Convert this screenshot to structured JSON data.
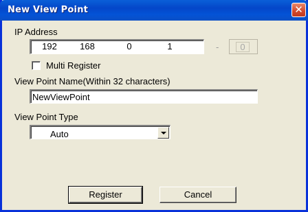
{
  "window": {
    "title": "New View Point",
    "close_glyph": "✕",
    "close_icon": "close-icon",
    "title_color": "#0a53d8"
  },
  "ip_address": {
    "label": "IP Address",
    "octets": [
      "192",
      "168",
      "0",
      "1"
    ],
    "range_separator": "-",
    "range_end": "0"
  },
  "multi_register": {
    "label": "Multi Register",
    "checked": false
  },
  "view_point_name": {
    "label": "View Point Name(Within 32 characters)",
    "value": "NewViewPoint"
  },
  "view_point_type": {
    "label": "View Point Type",
    "selected": "Auto"
  },
  "buttons": {
    "register": "Register",
    "cancel": "Cancel"
  }
}
